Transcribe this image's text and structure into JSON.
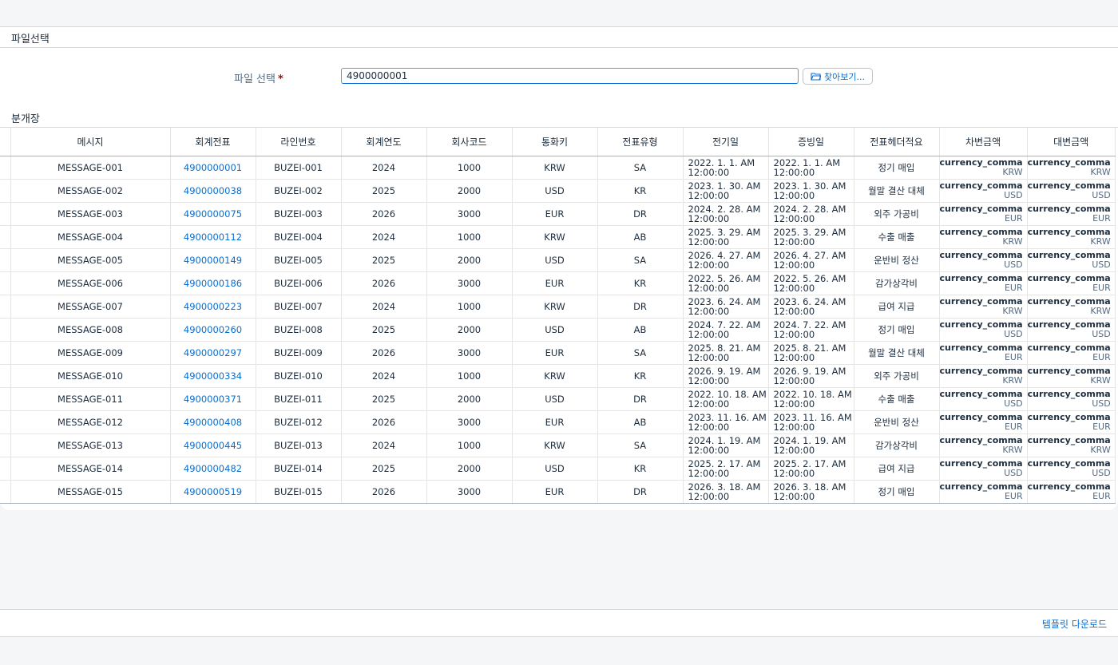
{
  "file_section": {
    "title": "파일선택",
    "label": "파일 선택",
    "required_mark": "*",
    "input_value": "4900000001",
    "browse_label": "찾아보기..."
  },
  "ledger": {
    "title": "분개장",
    "columns": [
      "메시지",
      "회계전표",
      "라인번호",
      "회계연도",
      "회사코드",
      "통화키",
      "전표유형",
      "전기일",
      "증빙일",
      "전표헤더적요",
      "차변금액",
      "대변금액"
    ],
    "rows": [
      [
        "MESSAGE-001",
        "4900000001",
        "BUZEI-001",
        "2024",
        "1000",
        "KRW",
        "SA",
        "2022. 1. 1. AM",
        "12:00:00",
        "2022. 1. 1. AM",
        "12:00:00",
        "정기 매입",
        "currency_comma",
        "KRW",
        "currency_comma",
        "KRW"
      ],
      [
        "MESSAGE-002",
        "4900000038",
        "BUZEI-002",
        "2025",
        "2000",
        "USD",
        "KR",
        "2023. 1. 30. AM",
        "12:00:00",
        "2023. 1. 30. AM",
        "12:00:00",
        "월말 결산 대체",
        "currency_comma",
        "USD",
        "currency_comma",
        "USD"
      ],
      [
        "MESSAGE-003",
        "4900000075",
        "BUZEI-003",
        "2026",
        "3000",
        "EUR",
        "DR",
        "2024. 2. 28. AM",
        "12:00:00",
        "2024. 2. 28. AM",
        "12:00:00",
        "외주 가공비",
        "currency_comma",
        "EUR",
        "currency_comma",
        "EUR"
      ],
      [
        "MESSAGE-004",
        "4900000112",
        "BUZEI-004",
        "2024",
        "1000",
        "KRW",
        "AB",
        "2025. 3. 29. AM",
        "12:00:00",
        "2025. 3. 29. AM",
        "12:00:00",
        "수출 매출",
        "currency_comma",
        "KRW",
        "currency_comma",
        "KRW"
      ],
      [
        "MESSAGE-005",
        "4900000149",
        "BUZEI-005",
        "2025",
        "2000",
        "USD",
        "SA",
        "2026. 4. 27. AM",
        "12:00:00",
        "2026. 4. 27. AM",
        "12:00:00",
        "운반비 정산",
        "currency_comma",
        "USD",
        "currency_comma",
        "USD"
      ],
      [
        "MESSAGE-006",
        "4900000186",
        "BUZEI-006",
        "2026",
        "3000",
        "EUR",
        "KR",
        "2022. 5. 26. AM",
        "12:00:00",
        "2022. 5. 26. AM",
        "12:00:00",
        "감가상각비",
        "currency_comma",
        "EUR",
        "currency_comma",
        "EUR"
      ],
      [
        "MESSAGE-007",
        "4900000223",
        "BUZEI-007",
        "2024",
        "1000",
        "KRW",
        "DR",
        "2023. 6. 24. AM",
        "12:00:00",
        "2023. 6. 24. AM",
        "12:00:00",
        "급여 지급",
        "currency_comma",
        "KRW",
        "currency_comma",
        "KRW"
      ],
      [
        "MESSAGE-008",
        "4900000260",
        "BUZEI-008",
        "2025",
        "2000",
        "USD",
        "AB",
        "2024. 7. 22. AM",
        "12:00:00",
        "2024. 7. 22. AM",
        "12:00:00",
        "정기 매입",
        "currency_comma",
        "USD",
        "currency_comma",
        "USD"
      ],
      [
        "MESSAGE-009",
        "4900000297",
        "BUZEI-009",
        "2026",
        "3000",
        "EUR",
        "SA",
        "2025. 8. 21. AM",
        "12:00:00",
        "2025. 8. 21. AM",
        "12:00:00",
        "월말 결산 대체",
        "currency_comma",
        "EUR",
        "currency_comma",
        "EUR"
      ],
      [
        "MESSAGE-010",
        "4900000334",
        "BUZEI-010",
        "2024",
        "1000",
        "KRW",
        "KR",
        "2026. 9. 19. AM",
        "12:00:00",
        "2026. 9. 19. AM",
        "12:00:00",
        "외주 가공비",
        "currency_comma",
        "KRW",
        "currency_comma",
        "KRW"
      ],
      [
        "MESSAGE-011",
        "4900000371",
        "BUZEI-011",
        "2025",
        "2000",
        "USD",
        "DR",
        "2022. 10. 18. AM",
        "12:00:00",
        "2022. 10. 18. AM",
        "12:00:00",
        "수출 매출",
        "currency_comma",
        "USD",
        "currency_comma",
        "USD"
      ],
      [
        "MESSAGE-012",
        "4900000408",
        "BUZEI-012",
        "2026",
        "3000",
        "EUR",
        "AB",
        "2023. 11. 16. AM",
        "12:00:00",
        "2023. 11. 16. AM",
        "12:00:00",
        "운반비 정산",
        "currency_comma",
        "EUR",
        "currency_comma",
        "EUR"
      ],
      [
        "MESSAGE-013",
        "4900000445",
        "BUZEI-013",
        "2024",
        "1000",
        "KRW",
        "SA",
        "2024. 1. 19. AM",
        "12:00:00",
        "2024. 1. 19. AM",
        "12:00:00",
        "감가상각비",
        "currency_comma",
        "KRW",
        "currency_comma",
        "KRW"
      ],
      [
        "MESSAGE-014",
        "4900000482",
        "BUZEI-014",
        "2025",
        "2000",
        "USD",
        "KR",
        "2025. 2. 17. AM",
        "12:00:00",
        "2025. 2. 17. AM",
        "12:00:00",
        "급여 지급",
        "currency_comma",
        "USD",
        "currency_comma",
        "USD"
      ],
      [
        "MESSAGE-015",
        "4900000519",
        "BUZEI-015",
        "2026",
        "3000",
        "EUR",
        "DR",
        "2026. 3. 18. AM",
        "12:00:00",
        "2026. 3. 18. AM",
        "12:00:00",
        "정기 매입",
        "currency_comma",
        "EUR",
        "currency_comma",
        "EUR"
      ]
    ]
  },
  "footer": {
    "template_download": "템플릿 다운로드"
  },
  "icons": {
    "browse": "folder-open-icon"
  },
  "colors": {
    "link": "#0a6ed1",
    "required": "#aa0808"
  }
}
